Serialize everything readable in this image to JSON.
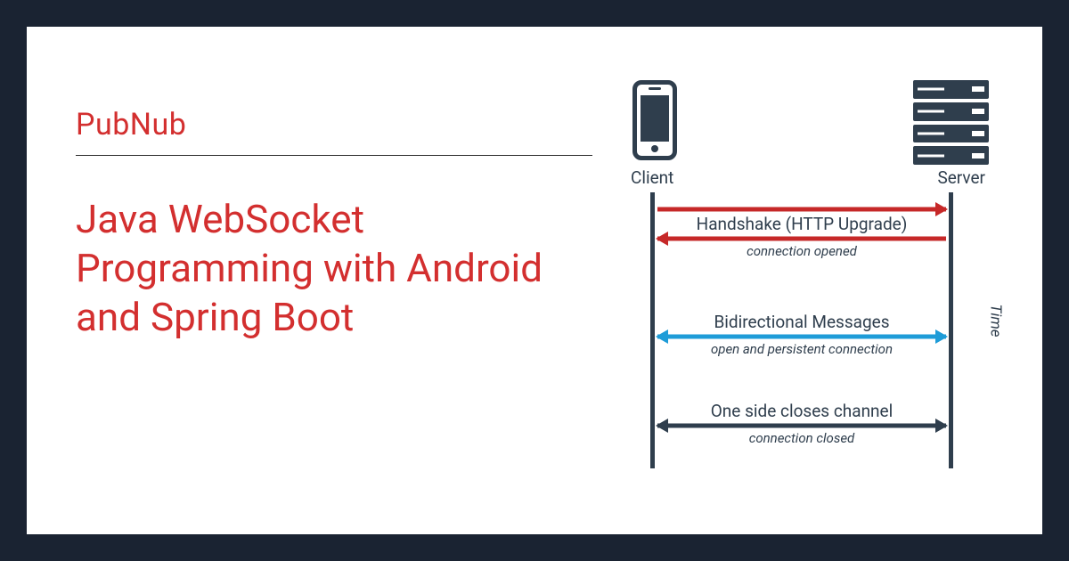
{
  "brand": "PubNub",
  "title": "Java WebSocket Programming with Android and Spring Boot",
  "diagram": {
    "client_label": "Client",
    "server_label": "Server",
    "time_label": "Time",
    "messages": [
      {
        "primary": "Handshake (HTTP Upgrade)",
        "secondary": "connection opened"
      },
      {
        "primary": "Bidirectional Messages",
        "secondary": "open and persistent connection"
      },
      {
        "primary": "One side closes channel",
        "secondary": "connection closed"
      }
    ]
  }
}
